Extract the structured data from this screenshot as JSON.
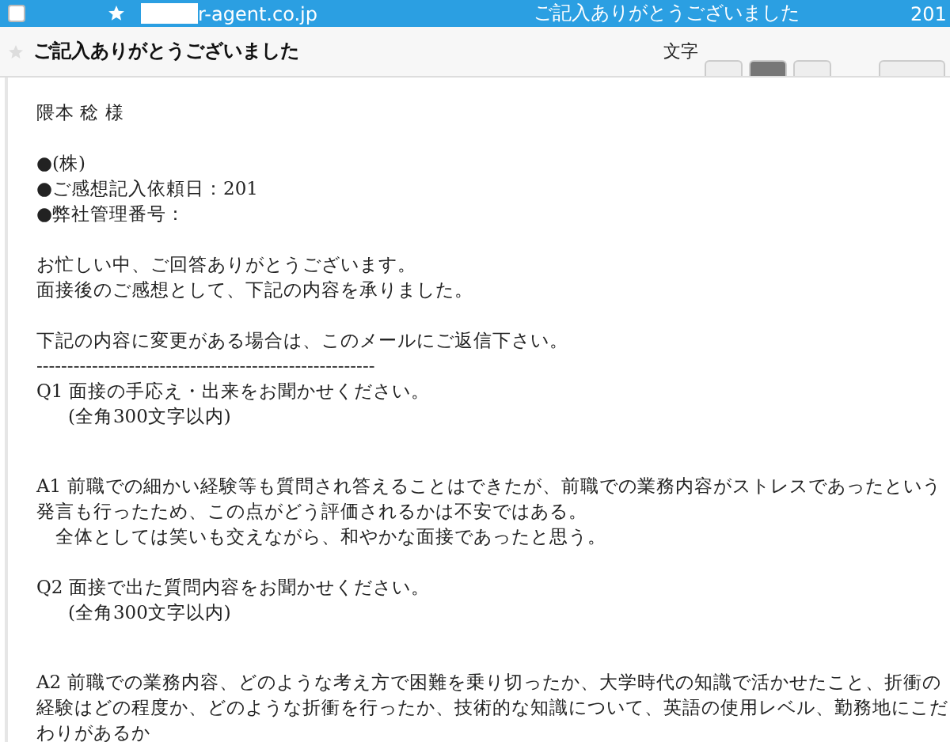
{
  "message_list_row": {
    "selected": true,
    "checked": false,
    "starred": false,
    "sender": "r-agent.co.jp",
    "subject": "ご記入ありがとうございました",
    "date": "201"
  },
  "message": {
    "subject": "ご記入ありがとうございました",
    "starred": false,
    "toolbar_label": "文字",
    "paragraphs": [
      {
        "kind": "plain",
        "lines": [
          "隈本 稔 様"
        ]
      },
      {
        "kind": "plain",
        "lines": [
          "●(株)",
          "●ご感想記入依頼日：201",
          "●弊社管理番号："
        ]
      },
      {
        "kind": "plain",
        "lines": [
          "お忙しい中、ご回答ありがとうございます。",
          "面接後のご感想として、下記の内容を承りました。"
        ]
      },
      {
        "kind": "tight",
        "lines": [
          "下記の内容に変更がある場合は、このメールにご返信下さい。",
          "-------------------------------------------------------"
        ]
      },
      {
        "kind": "question",
        "lines": [
          "Q1 面接の手応え・出来をお聞かせください。",
          "(全角300文字以内)"
        ]
      },
      {
        "kind": "plain",
        "lines": [
          "A1 前職での細かい経験等も質問され答えることはできたが、前職での業務内容がストレスであったという発言も行ったため、この点がどう評価されるかは不安ではある。",
          "　全体としては笑いも交えながら、和やかな面接であったと思う。"
        ]
      },
      {
        "kind": "question",
        "lines": [
          "Q2 面接で出た質問内容をお聞かせください。",
          "(全角300文字以内)"
        ]
      },
      {
        "kind": "plain",
        "lines": [
          "A2 前職での業務内容、どのような考え方で困難を乗り切ったか、大学時代の知識で活かせたこと、折衝の経験はどの程度か、どのような折衝を行ったか、技術的な知識について、英語の使用レベル、勤務地にこだわりがあるか"
        ]
      }
    ]
  }
}
